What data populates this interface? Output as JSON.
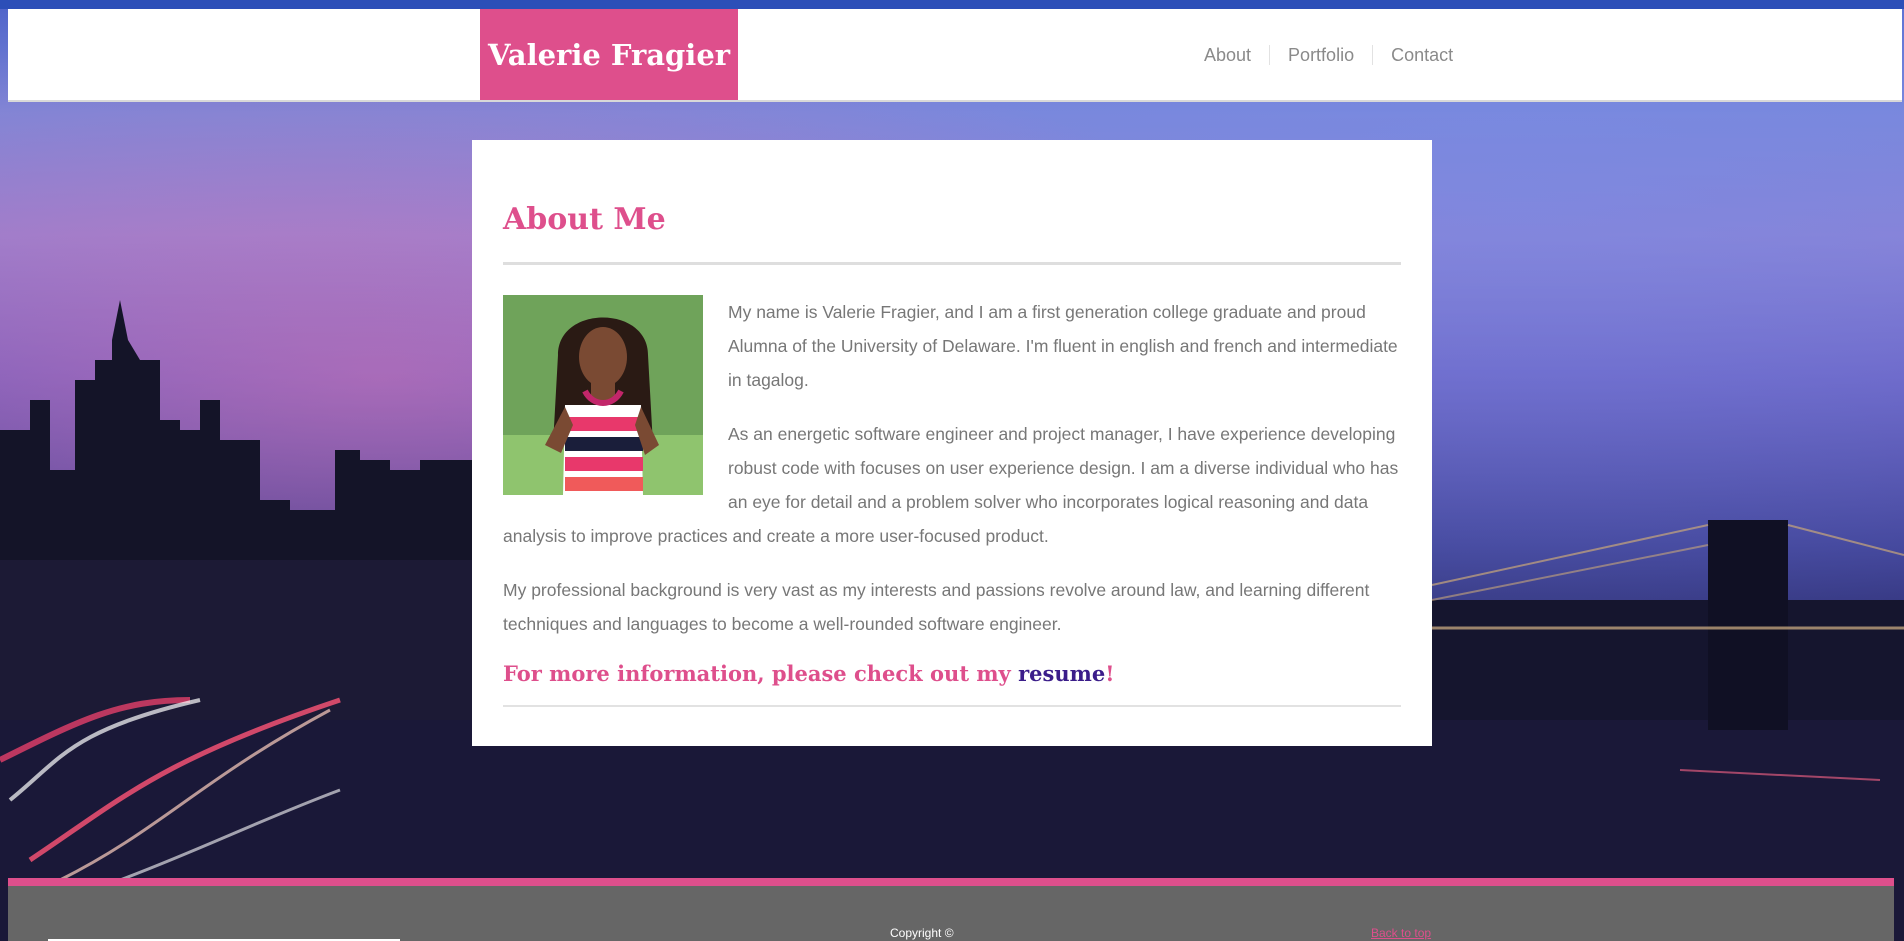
{
  "site": {
    "brand_name": "Valerie Fragier",
    "colors": {
      "accent": "#de4f8c",
      "link": "#3b1d8a",
      "footer": "#666666"
    }
  },
  "nav": {
    "items": [
      {
        "label": "About"
      },
      {
        "label": "Portfolio"
      },
      {
        "label": "Contact"
      }
    ]
  },
  "about": {
    "heading": "About Me",
    "paragraphs": [
      "My name is Valerie Fragier, and I am a first generation college graduate and proud Alumna of the University of Delaware. I'm fluent in english and french and intermediate in tagalog.",
      "As an energetic software engineer and project manager, I have experience developing robust code with focuses on user experience design. I am a diverse individual who has an eye for detail and a problem solver who incorporates logical reasoning and data analysis to improve practices and create a more user-focused product.",
      "My professional background is very vast as my interests and passions revolve around law, and learning different techniques and languages to become a well-rounded software engineer."
    ],
    "more_info_prefix": "For more information, please check out my ",
    "more_info_link": "resume",
    "more_info_suffix": "!"
  },
  "footer": {
    "copyright": "Copyright ©",
    "back_to_top": "Back to top"
  }
}
